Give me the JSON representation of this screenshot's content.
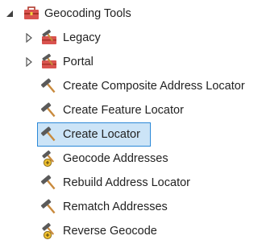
{
  "tree": {
    "root": {
      "label": "Geocoding Tools",
      "expanded": true,
      "icon": "toolbox-icon"
    },
    "items": [
      {
        "label": "Legacy",
        "type": "toolset",
        "expandable": true,
        "icon": "toolset-icon"
      },
      {
        "label": "Portal",
        "type": "toolset",
        "expandable": true,
        "icon": "toolset-icon"
      },
      {
        "label": "Create Composite Address Locator",
        "type": "tool",
        "icon": "hammer-icon"
      },
      {
        "label": "Create Feature Locator",
        "type": "tool",
        "icon": "hammer-icon"
      },
      {
        "label": "Create Locator",
        "type": "tool",
        "icon": "hammer-icon",
        "selected": true
      },
      {
        "label": "Geocode Addresses",
        "type": "tool",
        "icon": "hammer-script-icon"
      },
      {
        "label": "Rebuild Address Locator",
        "type": "tool",
        "icon": "hammer-icon"
      },
      {
        "label": "Rematch Addresses",
        "type": "tool",
        "icon": "hammer-icon"
      },
      {
        "label": "Reverse Geocode",
        "type": "tool",
        "icon": "hammer-script-icon"
      }
    ]
  },
  "colors": {
    "selection_bg": "#cce4f7",
    "selection_border": "#2b88d8",
    "toolbox_red": "#c8463a",
    "hammer_head": "#5a5a5a",
    "hammer_handle": "#c98a3d",
    "script_badge": "#f2c230"
  }
}
